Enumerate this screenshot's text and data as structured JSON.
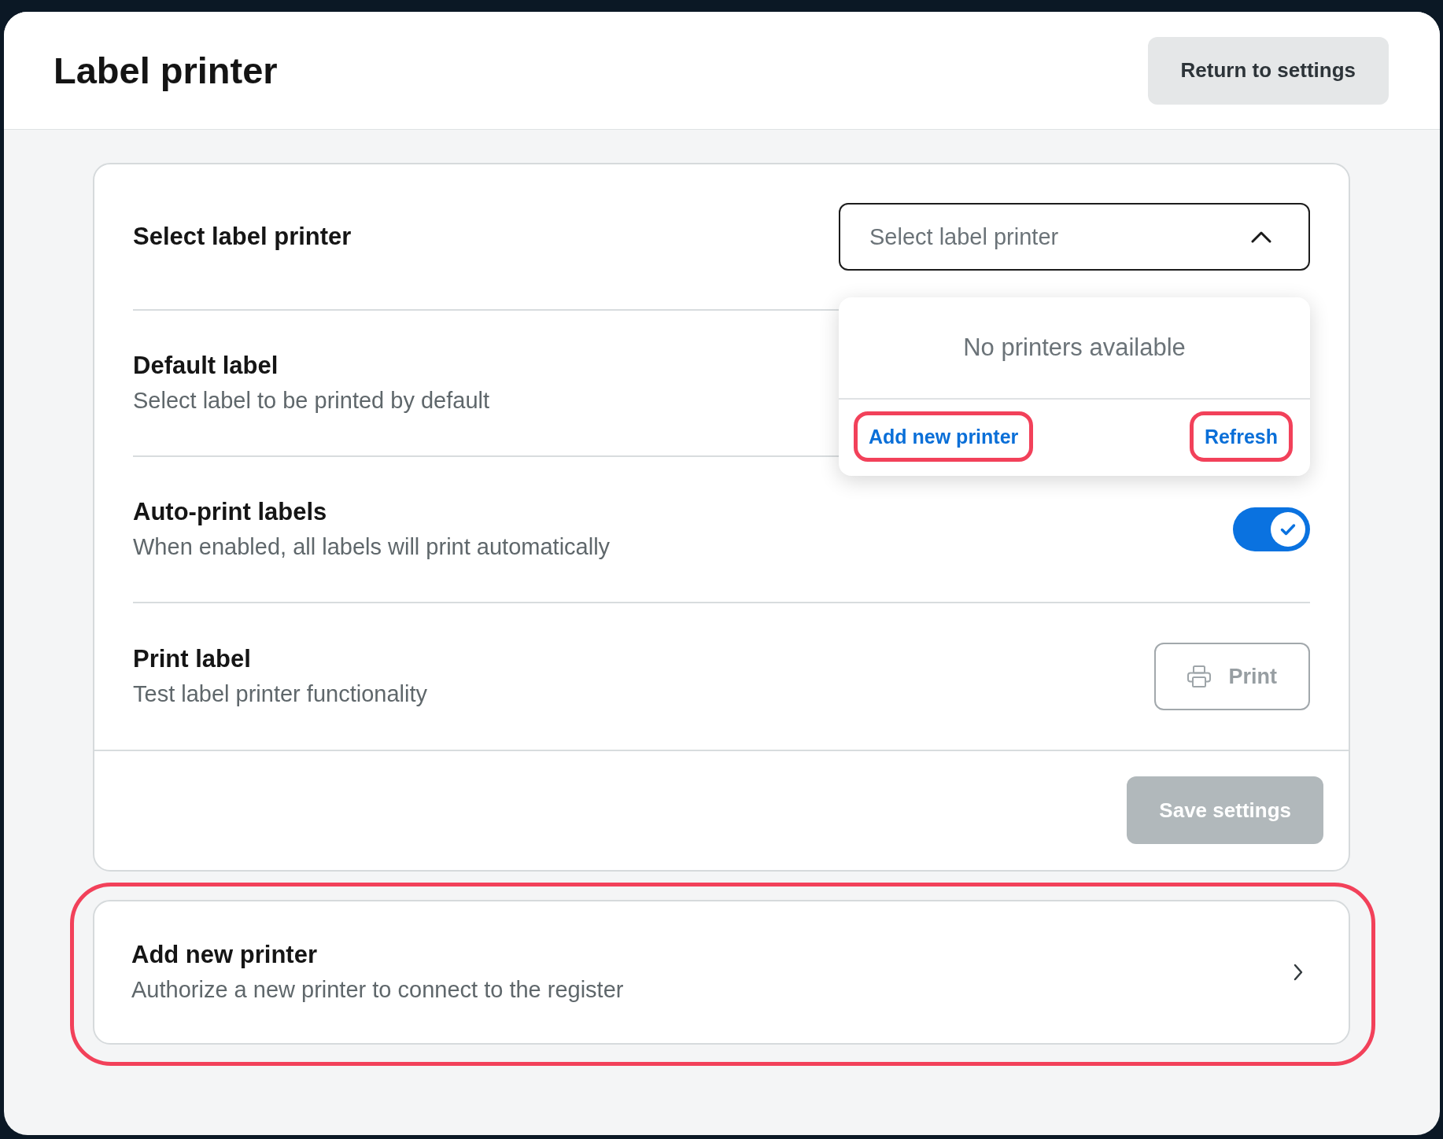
{
  "header": {
    "title": "Label printer",
    "action": "Return to settings"
  },
  "settings": {
    "rows": [
      {
        "kind": "select",
        "title": "Select label printer",
        "placeholder": "Select label printer",
        "expanded": true,
        "menu": {
          "empty_message": "No printers available",
          "actions": [
            {
              "label": "Add new printer",
              "highlighted": true
            },
            {
              "label": "Refresh",
              "highlighted": true
            }
          ]
        }
      },
      {
        "kind": "plain",
        "title": "Default label",
        "subtitle": "Select label to be printed by default"
      },
      {
        "kind": "toggle",
        "title": "Auto-print labels",
        "subtitle": "When enabled, all labels will print automatically",
        "on": true
      },
      {
        "kind": "button",
        "title": "Print label",
        "subtitle": "Test label printer functionality",
        "button": "Print",
        "disabled": true
      }
    ],
    "save_button": {
      "label": "Save settings",
      "disabled": true
    }
  },
  "add_printer": {
    "title": "Add new printer",
    "subtitle": "Authorize a new printer to connect to the register",
    "highlighted": true
  }
}
